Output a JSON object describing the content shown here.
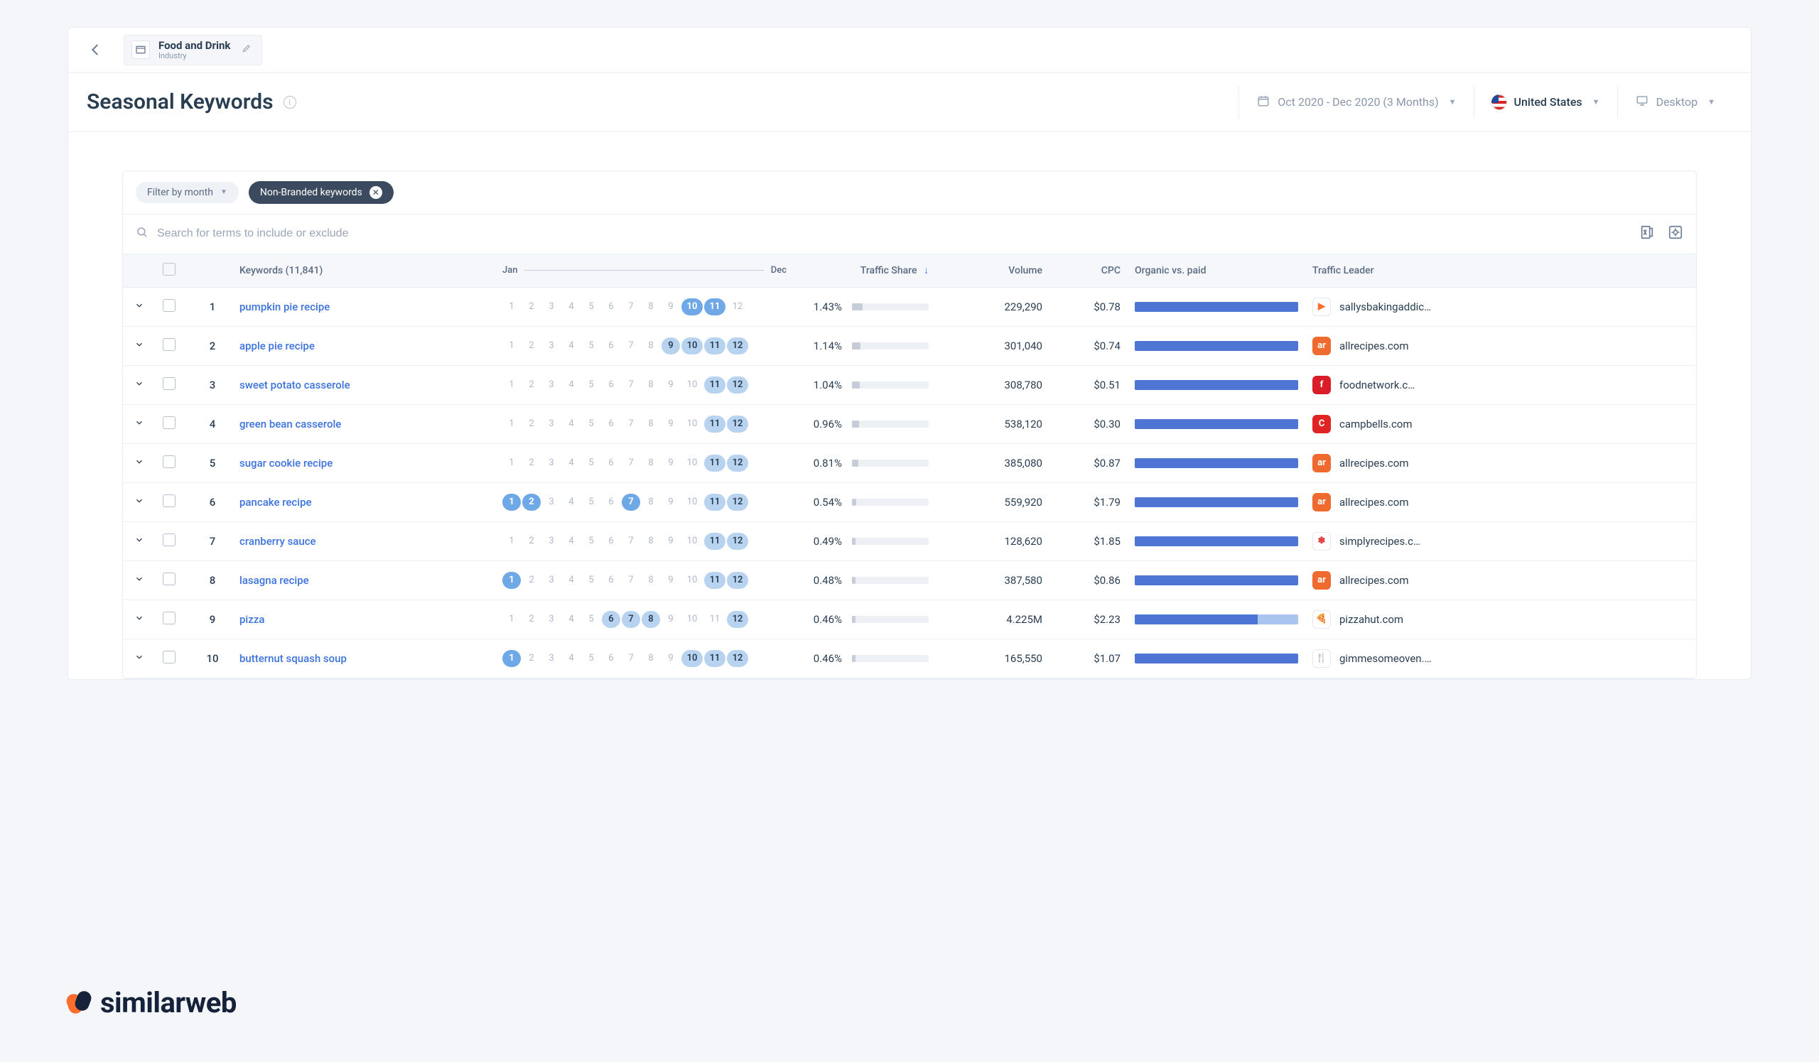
{
  "chip": {
    "title": "Food and Drink",
    "subtitle": "Industry"
  },
  "page_title": "Seasonal Keywords",
  "controls": {
    "date_range": "Oct 2020 - Dec 2020 (3 Months)",
    "country": "United States",
    "device": "Desktop"
  },
  "filters": {
    "month_filter_label": "Filter by month",
    "active_chip": "Non-Branded keywords"
  },
  "search_placeholder": "Search for terms to include or exclude",
  "columns": {
    "keywords": "Keywords (11,841)",
    "jan": "Jan",
    "dec": "Dec",
    "traffic_share": "Traffic Share",
    "volume": "Volume",
    "cpc": "CPC",
    "ovp": "Organic vs. paid",
    "leader": "Traffic Leader"
  },
  "rows": [
    {
      "rank": "1",
      "keyword": "pumpkin pie recipe",
      "months_strong": [
        10,
        11
      ],
      "months_hi": [],
      "share": "1.43%",
      "share_bar": 14,
      "volume": "229,290",
      "cpc": "$0.78",
      "ovp_organic": 100,
      "leader": "sallysbakingaddic…",
      "fav_bg": "#fff",
      "fav_txt": "▶",
      "fav_fg": "#ff6d2c",
      "fav_border": "#e4e8ef"
    },
    {
      "rank": "2",
      "keyword": "apple pie recipe",
      "months_strong": [],
      "months_hi": [
        9,
        10,
        11,
        12
      ],
      "share": "1.14%",
      "share_bar": 11,
      "volume": "301,040",
      "cpc": "$0.74",
      "ovp_organic": 100,
      "leader": "allrecipes.com",
      "fav_bg": "#ef6a2f",
      "fav_txt": "ar",
      "fav_fg": "#fff"
    },
    {
      "rank": "3",
      "keyword": "sweet potato casserole",
      "months_strong": [],
      "months_hi": [
        11,
        12
      ],
      "share": "1.04%",
      "share_bar": 10,
      "volume": "308,780",
      "cpc": "$0.51",
      "ovp_organic": 100,
      "leader": "foodnetwork.c…",
      "fav_bg": "#d91e2a",
      "fav_txt": "f",
      "fav_fg": "#fff"
    },
    {
      "rank": "4",
      "keyword": "green bean casserole",
      "months_strong": [],
      "months_hi": [
        11,
        12
      ],
      "share": "0.96%",
      "share_bar": 9,
      "volume": "538,120",
      "cpc": "$0.30",
      "ovp_organic": 100,
      "leader": "campbells.com",
      "fav_bg": "#e02424",
      "fav_txt": "C",
      "fav_fg": "#fff"
    },
    {
      "rank": "5",
      "keyword": "sugar cookie recipe",
      "months_strong": [],
      "months_hi": [
        11,
        12
      ],
      "share": "0.81%",
      "share_bar": 8,
      "volume": "385,080",
      "cpc": "$0.87",
      "ovp_organic": 100,
      "leader": "allrecipes.com",
      "fav_bg": "#ef6a2f",
      "fav_txt": "ar",
      "fav_fg": "#fff"
    },
    {
      "rank": "6",
      "keyword": "pancake recipe",
      "months_strong": [
        1,
        2,
        7
      ],
      "months_hi": [
        11,
        12
      ],
      "share": "0.54%",
      "share_bar": 6,
      "volume": "559,920",
      "cpc": "$1.79",
      "ovp_organic": 100,
      "leader": "allrecipes.com",
      "fav_bg": "#ef6a2f",
      "fav_txt": "ar",
      "fav_fg": "#fff"
    },
    {
      "rank": "7",
      "keyword": "cranberry sauce",
      "months_strong": [],
      "months_hi": [
        11,
        12
      ],
      "share": "0.49%",
      "share_bar": 5,
      "volume": "128,620",
      "cpc": "$1.85",
      "ovp_organic": 100,
      "leader": "simplyrecipes.c…",
      "fav_bg": "#fff",
      "fav_txt": "✽",
      "fav_fg": "#e04848",
      "fav_border": "#e4e8ef"
    },
    {
      "rank": "8",
      "keyword": "lasagna recipe",
      "months_strong": [
        1
      ],
      "months_hi": [
        11,
        12
      ],
      "share": "0.48%",
      "share_bar": 5,
      "volume": "387,580",
      "cpc": "$0.86",
      "ovp_organic": 100,
      "leader": "allrecipes.com",
      "fav_bg": "#ef6a2f",
      "fav_txt": "ar",
      "fav_fg": "#fff"
    },
    {
      "rank": "9",
      "keyword": "pizza",
      "months_strong": [],
      "months_hi": [
        6,
        7,
        8,
        12
      ],
      "share": "0.46%",
      "share_bar": 5,
      "volume": "4.225M",
      "cpc": "$2.23",
      "ovp_organic": 75,
      "leader": "pizzahut.com",
      "fav_bg": "#fff",
      "fav_txt": "🍕",
      "fav_fg": "#d91e2a",
      "fav_border": "#e4e8ef"
    },
    {
      "rank": "10",
      "keyword": "butternut squash soup",
      "months_strong": [
        1
      ],
      "months_hi": [
        10,
        11,
        12
      ],
      "share": "0.46%",
      "share_bar": 5,
      "volume": "165,550",
      "cpc": "$1.07",
      "ovp_organic": 100,
      "leader": "gimmesomeoven.…",
      "fav_bg": "#fff",
      "fav_txt": "🍴",
      "fav_fg": "#000",
      "fav_border": "#e4e8ef"
    }
  ],
  "brand": "similarweb"
}
